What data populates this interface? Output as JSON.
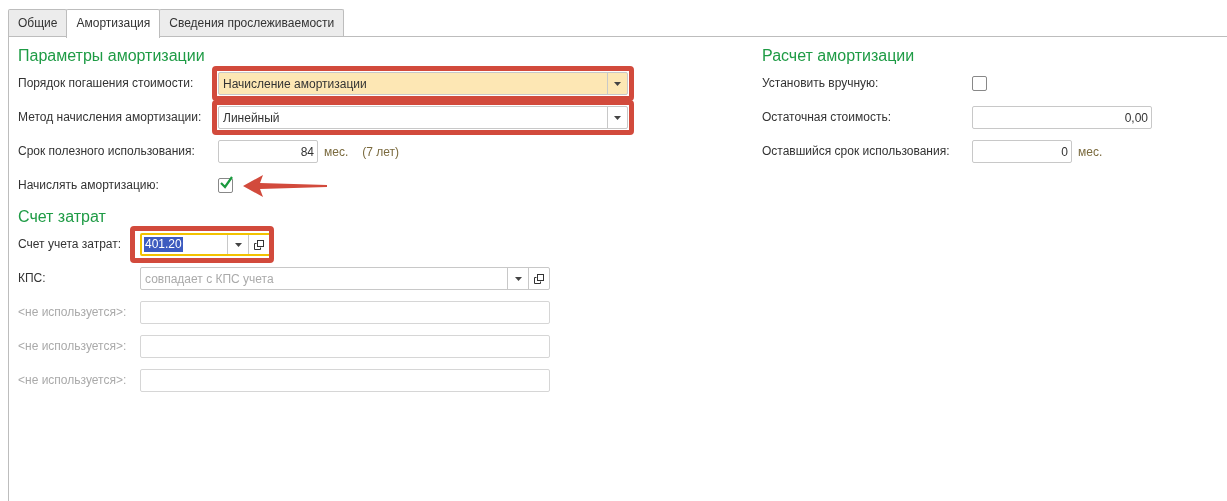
{
  "tabs": [
    {
      "label": "Общие",
      "selected": false
    },
    {
      "label": "Амортизация",
      "selected": true
    },
    {
      "label": "Сведения прослеживаемости",
      "selected": false
    }
  ],
  "left_sections": [
    {
      "title": "Параметры амортизации",
      "rows": [
        {
          "label": "Порядок погашения стоимости:",
          "kind": "dropdown",
          "value": "Начисление амортизации",
          "shaded": true,
          "highlighted": true
        },
        {
          "label": "Метод начисления амортизации:",
          "kind": "dropdown",
          "value": "Линейный",
          "highlighted": true
        },
        {
          "label": "Срок полезного использования:",
          "kind": "number",
          "value": "84",
          "unit": "мес.",
          "note": "(7 лет)"
        },
        {
          "label": "Начислять амортизацию:",
          "kind": "checkbox",
          "checked": true,
          "pointed_out": true
        }
      ]
    },
    {
      "title": "Счет затрат",
      "rows": [
        {
          "label": "Счет учета затрат:",
          "kind": "account",
          "value": "401.20",
          "highlighted": true,
          "focused": true
        },
        {
          "label": "КПС:",
          "kind": "account",
          "placeholder": "совпадает с КПС учета"
        },
        {
          "label": "<не используется>:",
          "kind": "text",
          "disabled": true
        },
        {
          "label": "<не используется>:",
          "kind": "text",
          "disabled": true
        },
        {
          "label": "<не используется>:",
          "kind": "text",
          "disabled": true
        }
      ]
    }
  ],
  "right_section": {
    "title": "Расчет амортизации",
    "rows": [
      {
        "label": "Установить вручную:",
        "kind": "checkbox",
        "checked": false
      },
      {
        "label": "Остаточная стоимость:",
        "kind": "number",
        "value": "0,00",
        "wide": true
      },
      {
        "label": "Оставшийся срок использования:",
        "kind": "number",
        "value": "0",
        "unit": "мес."
      }
    ]
  }
}
